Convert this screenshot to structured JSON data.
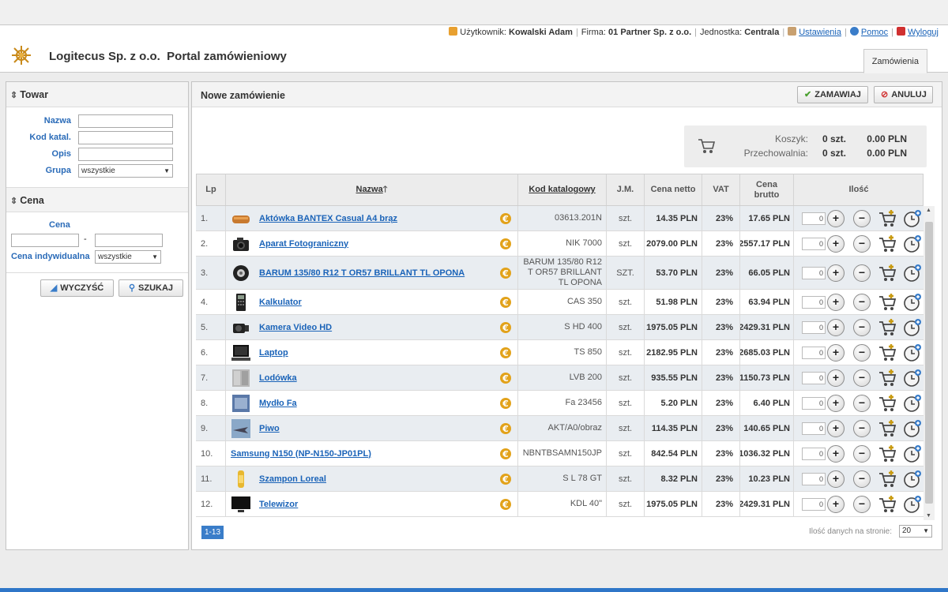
{
  "userbar": {
    "user_label": "Użytkownik:",
    "user_name": "Kowalski Adam",
    "company_label": "Firma:",
    "company_name": "01 Partner Sp. z o.o.",
    "unit_label": "Jednostka:",
    "unit_name": "Centrala",
    "settings": "Ustawienia",
    "help": "Pomoc",
    "logout": "Wyloguj"
  },
  "header": {
    "title": "Logitecus Sp. z o.o.  Portal zamówieniowy",
    "tab": "Zamówienia"
  },
  "sidebar": {
    "towar_title": "Towar",
    "nazwa_label": "Nazwa",
    "kod_label": "Kod katal.",
    "opis_label": "Opis",
    "grupa_label": "Grupa",
    "grupa_value": "wszystkie",
    "cena_title": "Cena",
    "cena_label": "Cena",
    "range_sep": "-",
    "cena_ind_label": "Cena indywidualna",
    "cena_ind_value": "wszystkie",
    "clear_button": "WYCZYŚĆ",
    "search_button": "SZUKAJ"
  },
  "main": {
    "title": "Nowe zamówienie",
    "order_button": "ZAMAWIAJ",
    "cancel_button": "ANULUJ",
    "cart": {
      "koszyk_label": "Koszyk:",
      "koszyk_qty": "0 szt.",
      "koszyk_value": "0.00 PLN",
      "przech_label": "Przechowalnia:",
      "przech_qty": "0 szt.",
      "przech_value": "0.00 PLN"
    },
    "columns": {
      "lp": "Lp",
      "nazwa": "Nazwa",
      "kod": "Kod katalogowy",
      "jm": "J.M.",
      "netto": "Cena netto",
      "vat": "VAT",
      "brutto_1": "Cena",
      "brutto_2": "brutto",
      "ilosc": "Ilość"
    },
    "rows": [
      {
        "lp": "1.",
        "name": "Aktówka BANTEX Casual A4 brąz",
        "kod": "03613.201N",
        "jm": "szt.",
        "netto": "14.35 PLN",
        "vat": "23%",
        "brutto": "17.65 PLN",
        "qty": "0",
        "thumb": "briefcase"
      },
      {
        "lp": "2.",
        "name": "Aparat Fotograniczny",
        "kod": "NIK 7000",
        "jm": "szt.",
        "netto": "2079.00 PLN",
        "vat": "23%",
        "brutto": "2557.17 PLN",
        "qty": "0",
        "thumb": "camera"
      },
      {
        "lp": "3.",
        "name": "BARUM 135/80 R12 T OR57 BRILLANT TL OPONA",
        "kod": "BARUM 135/80 R12 T OR57 BRILLANT TL OPONA",
        "jm": "SZT.",
        "netto": "53.70 PLN",
        "vat": "23%",
        "brutto": "66.05 PLN",
        "qty": "0",
        "thumb": "tire"
      },
      {
        "lp": "4.",
        "name": "Kalkulator",
        "kod": "CAS 350",
        "jm": "szt.",
        "netto": "51.98 PLN",
        "vat": "23%",
        "brutto": "63.94 PLN",
        "qty": "0",
        "thumb": "calculator"
      },
      {
        "lp": "5.",
        "name": "Kamera Video HD",
        "kod": "S HD 400",
        "jm": "szt.",
        "netto": "1975.05 PLN",
        "vat": "23%",
        "brutto": "2429.31 PLN",
        "qty": "0",
        "thumb": "videocam"
      },
      {
        "lp": "6.",
        "name": "Laptop",
        "kod": "TS 850",
        "jm": "szt.",
        "netto": "2182.95 PLN",
        "vat": "23%",
        "brutto": "2685.03 PLN",
        "qty": "0",
        "thumb": "laptop"
      },
      {
        "lp": "7.",
        "name": "Lodówka",
        "kod": "LVB 200",
        "jm": "szt.",
        "netto": "935.55 PLN",
        "vat": "23%",
        "brutto": "1150.73 PLN",
        "qty": "0",
        "thumb": "fridge"
      },
      {
        "lp": "8.",
        "name": "Mydło Fa",
        "kod": "Fa 23456",
        "jm": "szt.",
        "netto": "5.20 PLN",
        "vat": "23%",
        "brutto": "6.40 PLN",
        "qty": "0",
        "thumb": "soap"
      },
      {
        "lp": "9.",
        "name": "Piwo",
        "kod": "AKT/A0/obraz",
        "jm": "szt.",
        "netto": "114.35 PLN",
        "vat": "23%",
        "brutto": "140.65 PLN",
        "qty": "0",
        "thumb": "jet"
      },
      {
        "lp": "10.",
        "name": "Samsung N150 (NP-N150-JP01PL)",
        "kod": "NBNTBSAMN150JP",
        "jm": "szt.",
        "netto": "842.54 PLN",
        "vat": "23%",
        "brutto": "1036.32 PLN",
        "qty": "0",
        "thumb": ""
      },
      {
        "lp": "11.",
        "name": "Szampon Loreal",
        "kod": "S L 78 GT",
        "jm": "szt.",
        "netto": "8.32 PLN",
        "vat": "23%",
        "brutto": "10.23 PLN",
        "qty": "0",
        "thumb": "shampoo"
      },
      {
        "lp": "12.",
        "name": "Telewizor",
        "kod": "KDL 40\"",
        "jm": "szt.",
        "netto": "1975.05 PLN",
        "vat": "23%",
        "brutto": "2429.31 PLN",
        "qty": "0",
        "thumb": "tv"
      }
    ],
    "pager": "1-13",
    "per_page_label": "Ilość danych na stronie:",
    "per_page_value": "20"
  },
  "colors": {
    "link": "#1a63b8",
    "label_blue": "#2a6bb8",
    "row_alt": "#e9edf1",
    "accent": "#2f76c8",
    "euro_gold": "#e2a21a"
  }
}
